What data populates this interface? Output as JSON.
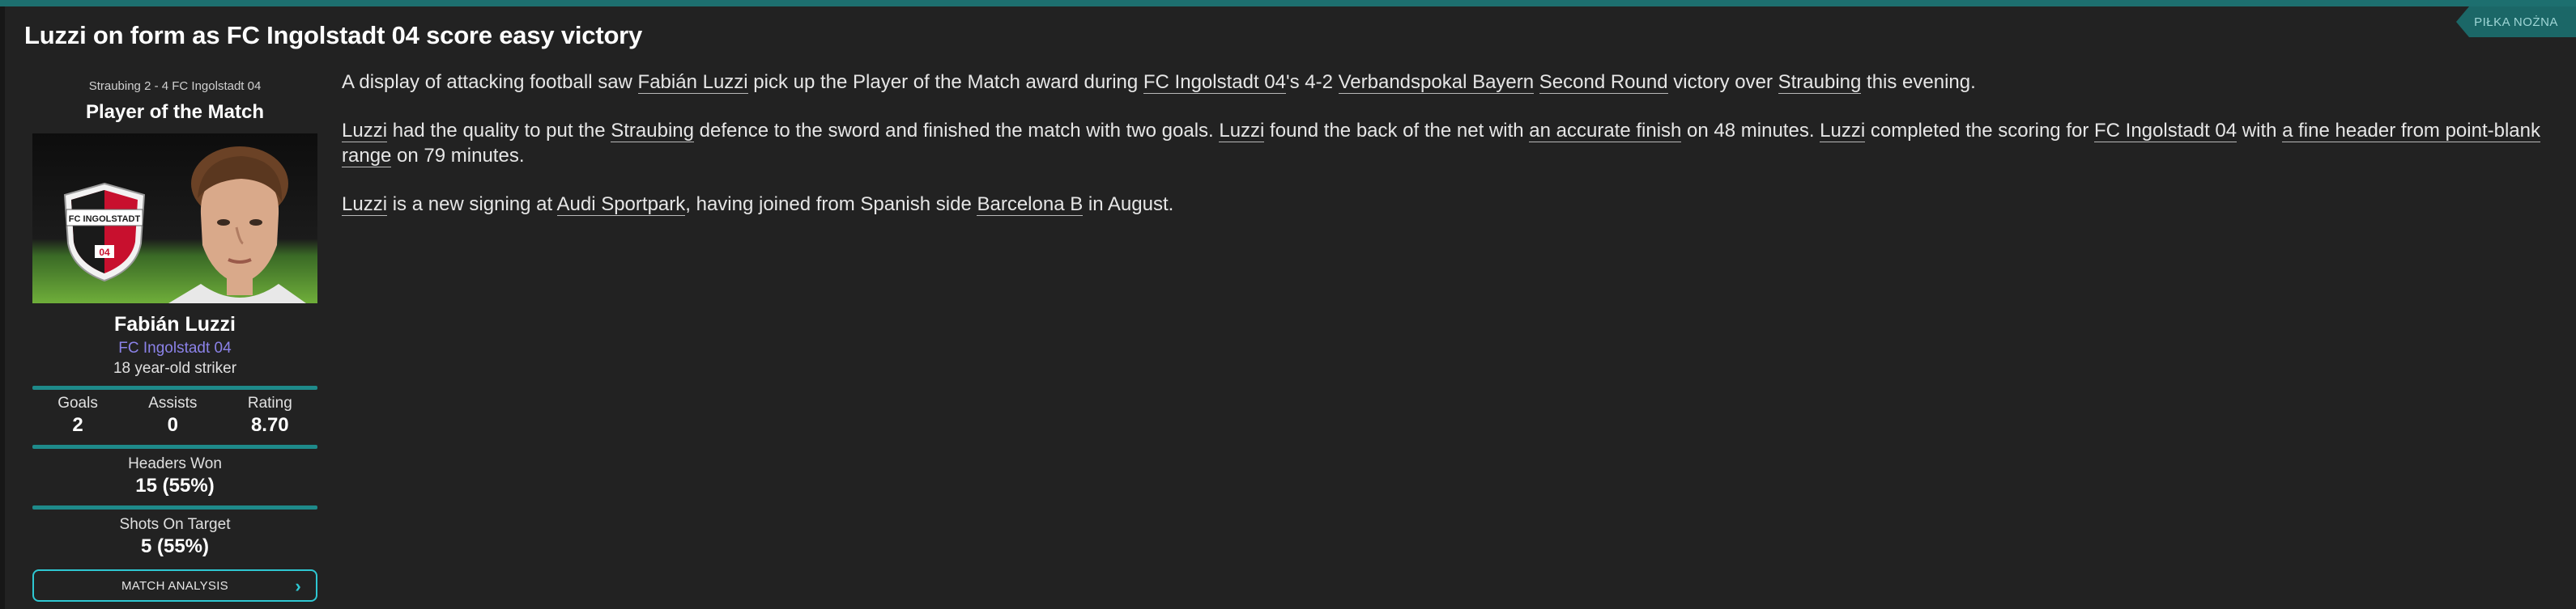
{
  "headline": "Luzzi on form as FC Ingolstadt 04 score easy victory",
  "category_badge": "PIŁKA NOŻNA",
  "sidebar": {
    "score_line": "Straubing 2 - 4 FC Ingolstadt 04",
    "award": "Player of the Match",
    "player_name": "Fabián Luzzi",
    "club": "FC Ingolstadt 04",
    "description": "18 year-old striker",
    "stats": [
      {
        "label": "Goals",
        "value": "2"
      },
      {
        "label": "Assists",
        "value": "0"
      },
      {
        "label": "Rating",
        "value": "8.70"
      }
    ],
    "headers_won": {
      "label": "Headers Won",
      "value": "15 (55%)"
    },
    "shots_on_target": {
      "label": "Shots On Target",
      "value": "5 (55%)"
    },
    "button_label": "MATCH ANALYSIS",
    "crest_text": "FC INGOLSTADT",
    "crest_number": "04",
    "colors": {
      "accent": "#1e8a8a",
      "button_border": "#2ec7d2",
      "club_link": "#8b82e8"
    }
  },
  "article": {
    "p1": {
      "t1": "A display of attacking football saw ",
      "l1": "Fabián Luzzi",
      "t2": " pick up the Player of the Match award during ",
      "l2": "FC Ingolstadt 04",
      "t3": "'s 4-2 ",
      "l3": "Verbandspokal Bayern",
      "t4": " ",
      "l4": "Second Round",
      "t5": " victory over ",
      "l5": "Straubing",
      "t6": " this evening."
    },
    "p2": {
      "l1": "Luzzi",
      "t1": " had the quality to put the ",
      "l2": "Straubing",
      "t2": " defence to the sword and finished the match with two goals. ",
      "l3": "Luzzi",
      "t3": " found the back of the net with ",
      "l4": "an accurate finish",
      "t4": " on 48 minutes. ",
      "l5": "Luzzi",
      "t5": " completed the scoring for ",
      "l6": "FC Ingolstadt 04",
      "t6": " with ",
      "l7": "a fine header from point-blank range",
      "t7": " on 79 minutes."
    },
    "p3": {
      "l1": "Luzzi",
      "t1": " is a new signing at ",
      "l2": "Audi Sportpark",
      "t2": ", having joined from Spanish side ",
      "l3": "Barcelona B",
      "t3": " in August."
    }
  }
}
